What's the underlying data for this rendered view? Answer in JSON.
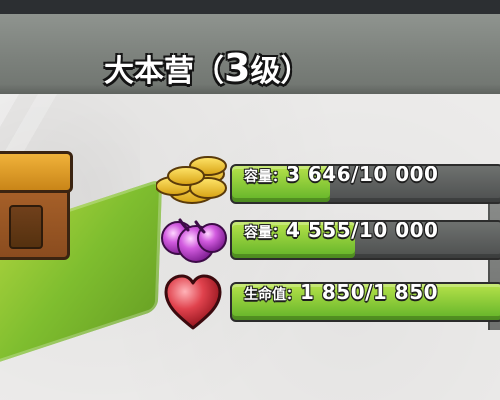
{
  "header": {
    "title_prefix": "大本营（",
    "title_level": "3",
    "title_suffix": "级）"
  },
  "stats": [
    {
      "key": "容量：",
      "value": "3 646/10 000",
      "current": 3646,
      "max": 10000,
      "color_top": "#b6e24a",
      "color_bottom": "#61b328",
      "icon": "gold-coins-icon"
    },
    {
      "key": "容量：",
      "value": "4 555/10 000",
      "current": 4555,
      "max": 10000,
      "color_top": "#b6e24a",
      "color_bottom": "#61b328",
      "icon": "elixir-drops-icon"
    },
    {
      "key": "生命值：",
      "value": "1 850/1 850",
      "current": 1850,
      "max": 1850,
      "color_top": "#b6e24a",
      "color_bottom": "#61b328",
      "icon": "heart-icon"
    }
  ]
}
